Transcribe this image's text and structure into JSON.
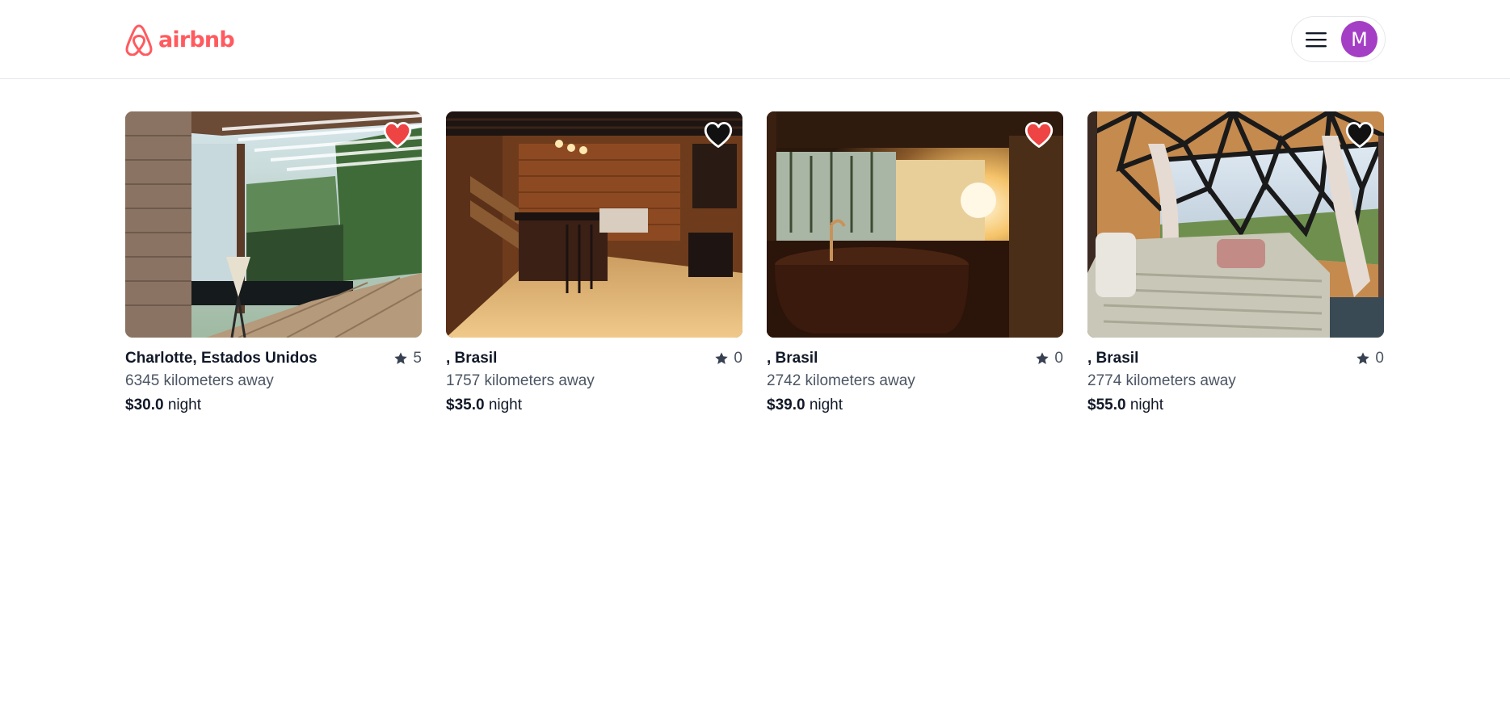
{
  "header": {
    "logo_text": "airbnb",
    "brand_color": "#ff5a5f",
    "avatar_letter": "M",
    "avatar_color": "#a43fc5"
  },
  "listings": [
    {
      "location": "Charlotte, Estados Unidos",
      "rating": "5",
      "distance": "6345 kilometers away",
      "price": "$30.0",
      "unit": "night",
      "favorited": true
    },
    {
      "location": ", Brasil",
      "rating": "0",
      "distance": "1757 kilometers away",
      "price": "$35.0",
      "unit": "night",
      "favorited": false
    },
    {
      "location": ", Brasil",
      "rating": "0",
      "distance": "2742 kilometers away",
      "price": "$39.0",
      "unit": "night",
      "favorited": true
    },
    {
      "location": ", Brasil",
      "rating": "0",
      "distance": "2774 kilometers away",
      "price": "$55.0",
      "unit": "night",
      "favorited": false
    }
  ]
}
